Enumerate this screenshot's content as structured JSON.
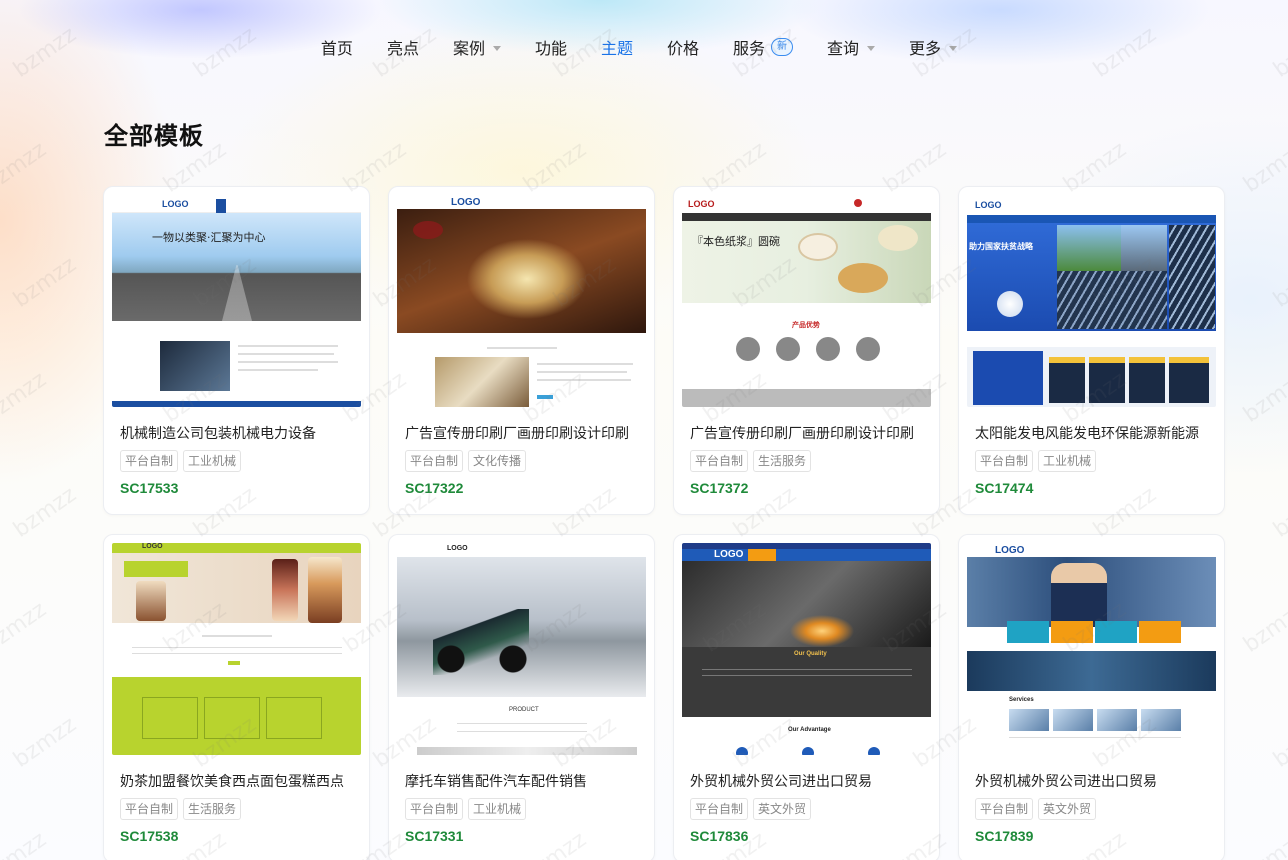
{
  "nav": {
    "items": [
      {
        "label": "首页",
        "active": false,
        "dropdown": false
      },
      {
        "label": "亮点",
        "active": false,
        "dropdown": false
      },
      {
        "label": "案例",
        "active": false,
        "dropdown": true
      },
      {
        "label": "功能",
        "active": false,
        "dropdown": false
      },
      {
        "label": "主题",
        "active": true,
        "dropdown": false
      },
      {
        "label": "价格",
        "active": false,
        "dropdown": false
      },
      {
        "label": "服务",
        "active": false,
        "dropdown": false,
        "badge": "新"
      },
      {
        "label": "查询",
        "active": false,
        "dropdown": true
      },
      {
        "label": "更多",
        "active": false,
        "dropdown": true
      }
    ],
    "active_color": "#1a73e8"
  },
  "page_title": "全部模板",
  "watermark_text": "bzmzz",
  "cards": [
    {
      "title": "机械制造公司包装机械电力设备",
      "tags": [
        "平台自制",
        "工业机械"
      ],
      "code": "SC17533",
      "thumb_caption": "一物以类聚·汇聚为中心",
      "thumb_logo": "LOGO"
    },
    {
      "title": "广告宣传册印刷厂画册印刷设计印刷",
      "tags": [
        "平台自制",
        "文化传播"
      ],
      "code": "SC17322",
      "thumb_logo": "LOGO"
    },
    {
      "title": "广告宣传册印刷厂画册印刷设计印刷",
      "tags": [
        "平台自制",
        "生活服务"
      ],
      "code": "SC17372",
      "thumb_caption": "『本色纸浆』圆碗",
      "thumb_sub": "产品优势",
      "thumb_logo": "LOGO"
    },
    {
      "title": "太阳能发电风能发电环保能源新能源",
      "tags": [
        "平台自制",
        "工业机械"
      ],
      "code": "SC17474",
      "thumb_caption": "助力国家扶贫战略",
      "thumb_logo": "LOGO"
    },
    {
      "title": "奶茶加盟餐饮美食西点面包蛋糕西点",
      "tags": [
        "平台自制",
        "生活服务"
      ],
      "code": "SC17538",
      "thumb_logo": "LOGO"
    },
    {
      "title": "摩托车销售配件汽车配件销售",
      "tags": [
        "平台自制",
        "工业机械"
      ],
      "code": "SC17331",
      "thumb_sub": "PRODUCT",
      "thumb_logo": "LOGO"
    },
    {
      "title": "外贸机械外贸公司进出口贸易",
      "tags": [
        "平台自制",
        "英文外贸"
      ],
      "code": "SC17836",
      "thumb_caption": "Our Quality",
      "thumb_sub": "Our Advantage",
      "thumb_logo": "LOGO"
    },
    {
      "title": "外贸机械外贸公司进出口贸易",
      "tags": [
        "平台自制",
        "英文外贸"
      ],
      "code": "SC17839",
      "thumb_sub": "Services",
      "thumb_logo": "LOGO"
    }
  ]
}
